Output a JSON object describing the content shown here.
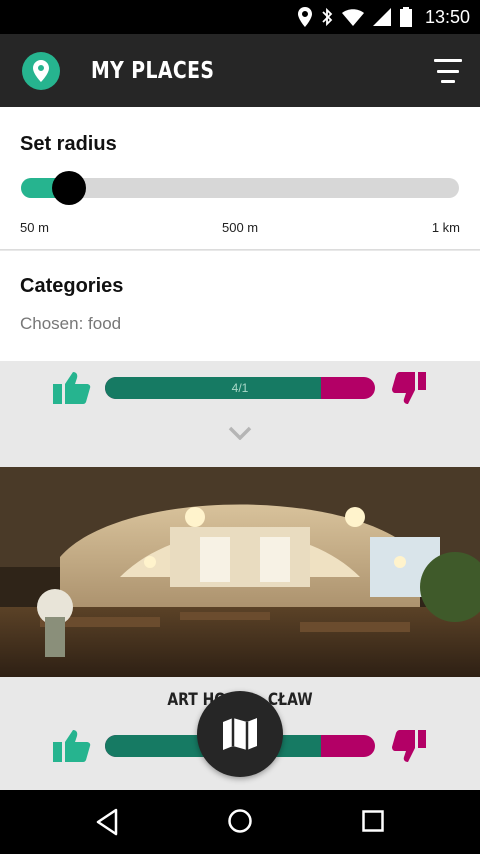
{
  "status_bar": {
    "time": "13:50",
    "icons": [
      "location-icon",
      "bluetooth-icon",
      "wifi-icon",
      "signal-icon",
      "battery-icon"
    ]
  },
  "app_bar": {
    "title": "MY PLACES",
    "logo_icon": "map-pin-icon",
    "menu_icon": "filter-icon"
  },
  "radius": {
    "title": "Set radius",
    "value_fraction": 0.11,
    "ticks": [
      "50 m",
      "500 m",
      "1 km"
    ]
  },
  "categories": {
    "title": "Categories",
    "chosen": "Chosen: food"
  },
  "places": [
    {
      "name": "",
      "vote_text": "4/1",
      "positive_fraction": 0.8,
      "expand_icon": "chevron-down-icon"
    },
    {
      "name": "ART HO   CŁAW",
      "vote_text": "",
      "positive_fraction": 0.8,
      "expand_icon": "chevron-down-icon"
    }
  ],
  "fab_icon": "map-icon",
  "colors": {
    "accent": "#26b48f",
    "vote_positive": "#167a63",
    "vote_negative": "#b30066",
    "app_bar": "#262626"
  },
  "nav": [
    "back-icon",
    "home-icon",
    "recents-icon"
  ]
}
